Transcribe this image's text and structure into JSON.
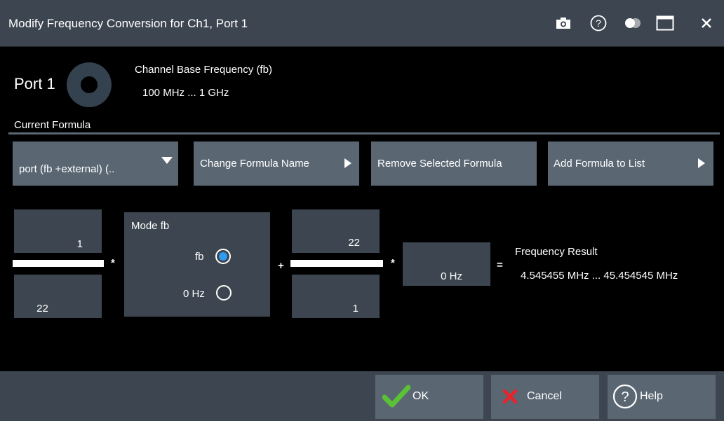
{
  "window": {
    "title": "Modify Frequency Conversion for Ch1, Port 1",
    "icons": [
      "camera-icon",
      "help-circle-icon",
      "transparency-icon",
      "maximize-icon",
      "close-icon"
    ]
  },
  "port": {
    "title": "Port 1",
    "base_freq_label": "Channel Base Frequency (fb)",
    "base_freq_value": "100 MHz ... 1 GHz"
  },
  "formula": {
    "section_label": "Current Formula",
    "selected": "port (fb +external) (..",
    "change_name_label": "Change Formula Name",
    "remove_label": "Remove Selected Formula",
    "add_label": "Add Formula to List"
  },
  "equation": {
    "numerator1": "1",
    "denominator1": "22",
    "mult1": "*",
    "mode_label": "Mode fb",
    "mode_options": [
      {
        "label": "fb",
        "selected": true
      },
      {
        "label": "0 Hz",
        "selected": false
      }
    ],
    "plus": "+",
    "numerator2": "22",
    "denominator2": "1",
    "mult2": "*",
    "offset": "0 Hz",
    "equals": "=",
    "result_label": "Frequency Result",
    "result_value": "4.545455 MHz ... 45.454545 MHz"
  },
  "footer": {
    "ok_label": "OK",
    "cancel_label": "Cancel",
    "help_label": "Help"
  },
  "colors": {
    "accent_blue": "#2d9bf0",
    "ok_green": "#5bc236",
    "cancel_red": "#e8232a"
  }
}
